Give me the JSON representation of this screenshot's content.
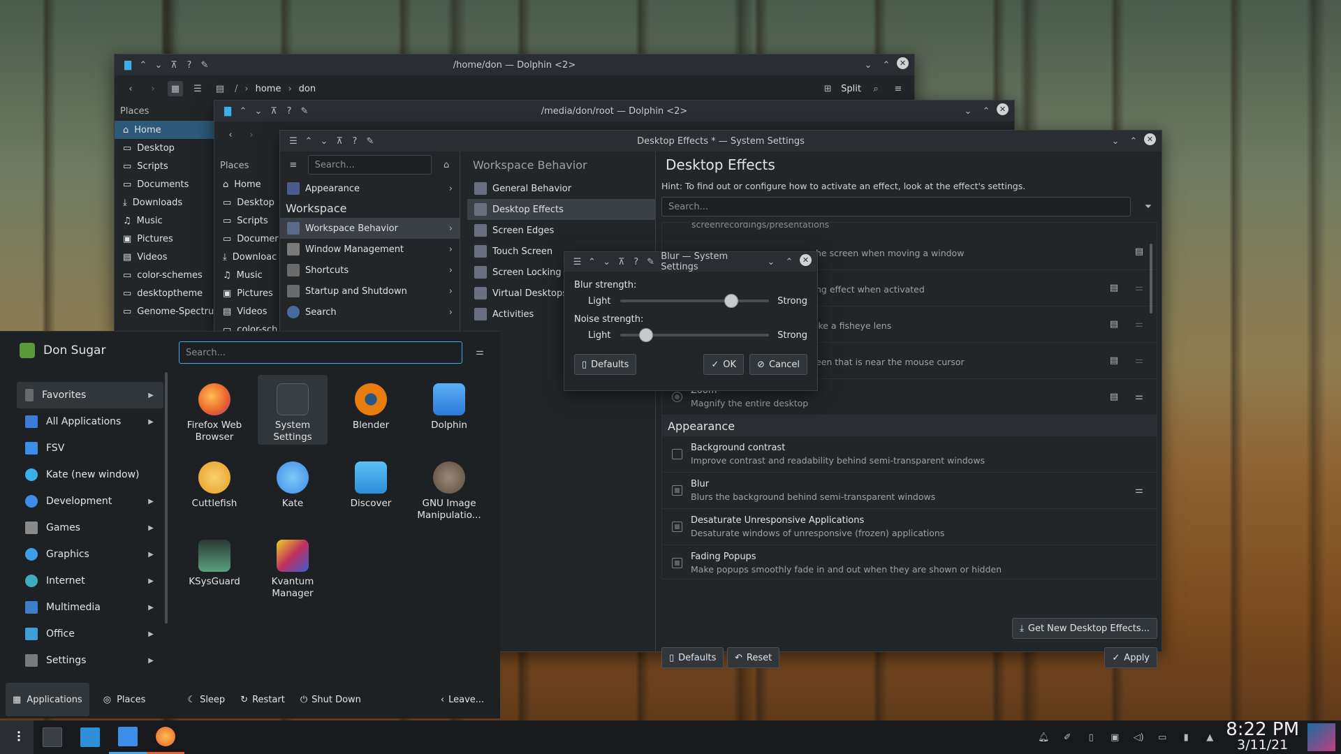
{
  "dolphin1": {
    "title": "/home/don — Dolphin <2>",
    "crumbs": [
      "home",
      "don"
    ],
    "split": "Split",
    "places_header": "Places",
    "places": [
      "Home",
      "Desktop",
      "Scripts",
      "Documents",
      "Downloads",
      "Music",
      "Pictures",
      "Videos",
      "color-schemes",
      "desktoptheme",
      "Genome-Spectrum"
    ]
  },
  "dolphin2": {
    "title": "/media/don/root — Dolphin <2>",
    "places_header": "Places",
    "places": [
      "Home",
      "Desktop",
      "Scripts",
      "Documer",
      "Downloac",
      "Music",
      "Pictures",
      "Videos",
      "color-sch"
    ]
  },
  "settings": {
    "title": "Desktop Effects * — System Settings",
    "search_placeholder": "Search...",
    "sidebar": [
      {
        "label": "Appearance",
        "color": "#4a5a8a"
      }
    ],
    "section": "Workspace",
    "workspace_items": [
      {
        "label": "Workspace Behavior",
        "color": "#5a6a8a"
      },
      {
        "label": "Window Management",
        "color": "#7a7a7a"
      },
      {
        "label": "Shortcuts",
        "color": "#6a6a6a"
      },
      {
        "label": "Startup and Shutdown",
        "color": "#6a6a6a"
      },
      {
        "label": "Search",
        "color": "#4a6a9a"
      }
    ],
    "sub_header": "Workspace Behavior",
    "sub_items": [
      {
        "label": "General Behavior",
        "color": "#6a7080"
      },
      {
        "label": "Desktop Effects",
        "color": "#6a7080"
      },
      {
        "label": "Screen Edges",
        "color": "#6a7080"
      },
      {
        "label": "Touch Screen",
        "color": "#6a7080"
      },
      {
        "label": "Screen Locking",
        "color": "#6a7080"
      },
      {
        "label": "Virtual Desktops",
        "color": "#6a7080"
      },
      {
        "label": "Activities",
        "color": "#6a7080"
      }
    ],
    "page_title": "Desktop Effects",
    "hint": "Hint: To find out or configure how to activate an effect, look at the effect's settings.",
    "effects_search_placeholder": "Search...",
    "partial_rows": [
      "screenrecordings/presentations",
      "he screen when moving a window",
      "ng effect when activated",
      "ike a fisheye lens",
      "een that is near the mouse cursor"
    ],
    "zoom": {
      "title": "Zoom",
      "desc": "Magnify the entire desktop"
    },
    "appearance_header": "Appearance",
    "appearance_effects": [
      {
        "title": "Background contrast",
        "desc": "Improve contrast and readability behind semi-transparent windows",
        "checked": false
      },
      {
        "title": "Blur",
        "desc": "Blurs the background behind semi-transparent windows",
        "checked": true
      },
      {
        "title": "Desaturate Unresponsive Applications",
        "desc": "Desaturate windows of unresponsive (frozen) applications",
        "checked": true
      },
      {
        "title": "Fading Popups",
        "desc": "Make popups smoothly fade in and out when they are shown or hidden",
        "checked": true
      }
    ],
    "get_new": "Get New Desktop Effects...",
    "defaults": "Defaults",
    "reset": "Reset",
    "apply": "Apply"
  },
  "blur": {
    "title": "Blur — System Settings",
    "blur_label": "Blur strength:",
    "noise_label": "Noise strength:",
    "light": "Light",
    "strong": "Strong",
    "blur_value": 0.77,
    "noise_value": 0.14,
    "defaults": "Defaults",
    "ok": "OK",
    "cancel": "Cancel"
  },
  "launcher": {
    "user": "Don Sugar",
    "search_placeholder": "Search...",
    "categories": [
      {
        "label": "Favorites",
        "arrow": true,
        "color": "#6a6a6a"
      },
      {
        "label": "All Applications",
        "arrow": true,
        "color": "#3d7bd9"
      },
      {
        "label": "FSV",
        "arrow": false,
        "color": "#3d8ee9"
      },
      {
        "label": "Kate (new window)",
        "arrow": false,
        "color": "#3daee9"
      },
      {
        "label": "Development",
        "arrow": true,
        "color": "#3d8ee9"
      },
      {
        "label": "Games",
        "arrow": true,
        "color": "#8a8a8a"
      },
      {
        "label": "Graphics",
        "arrow": true,
        "color": "#3d9ee9"
      },
      {
        "label": "Internet",
        "arrow": true,
        "color": "#3daeb9"
      },
      {
        "label": "Multimedia",
        "arrow": true,
        "color": "#3d7ec9"
      },
      {
        "label": "Office",
        "arrow": true,
        "color": "#3d9ed9"
      },
      {
        "label": "Settings",
        "arrow": true,
        "color": "#7a7a7a"
      }
    ],
    "apps": [
      {
        "label": "Firefox Web Browser",
        "color": "#e8612c"
      },
      {
        "label": "System Settings",
        "color": "#3b4046"
      },
      {
        "label": "Blender",
        "color": "#e87d0d"
      },
      {
        "label": "Dolphin",
        "color": "#3d8ee9"
      },
      {
        "label": "Cuttlefish",
        "color": "#f0b040"
      },
      {
        "label": "Kate",
        "color": "#3d9ee9"
      },
      {
        "label": "Discover",
        "color": "#3daee9"
      },
      {
        "label": "GNU Image Manipulatio...",
        "color": "#7a6a5a"
      },
      {
        "label": "KSysGuard",
        "color": "#5aa080"
      },
      {
        "label": "Kvantum Manager",
        "color": "#c03060"
      }
    ],
    "tabs": [
      "Applications",
      "Places"
    ],
    "power": [
      "Sleep",
      "Restart",
      "Shut Down"
    ],
    "leave": "Leave..."
  },
  "taskbar": {
    "time": "8:22 PM",
    "date": "3/11/21"
  }
}
